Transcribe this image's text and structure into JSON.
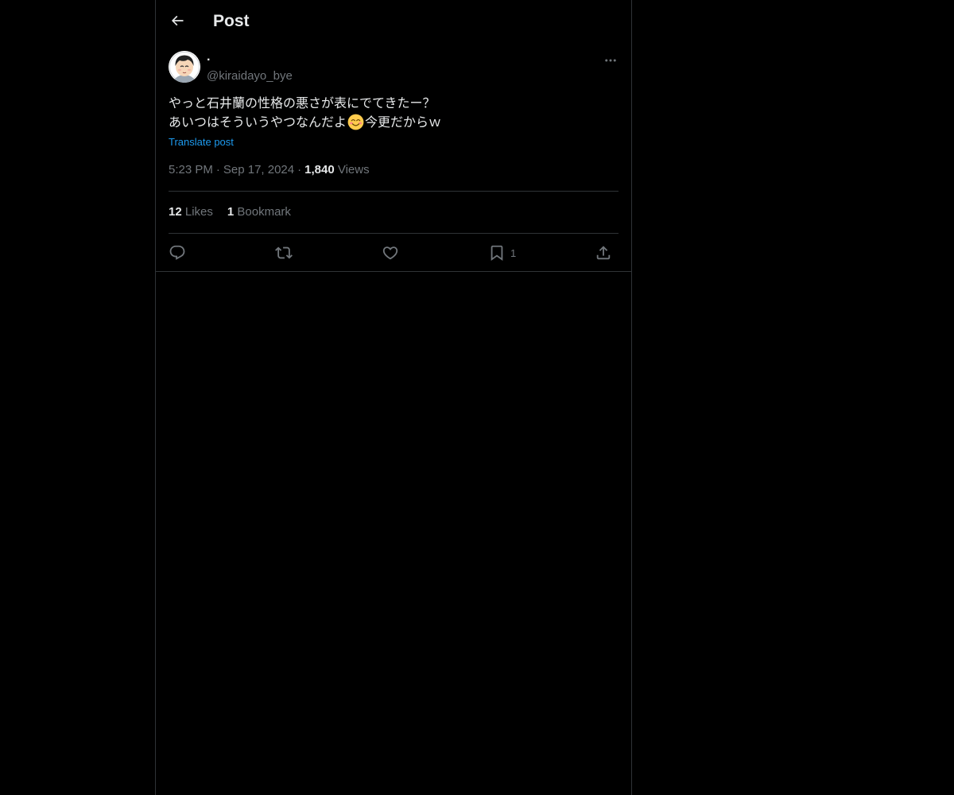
{
  "header": {
    "title": "Post"
  },
  "author": {
    "display_name": "·",
    "handle": "@kiraidayo_bye"
  },
  "post": {
    "line1": "やっと石井蘭の性格の悪さが表にでてきたー？",
    "line2_before_emoji": "あいつはそういうやつなんだよ",
    "emoji": "smiling-face-emoji",
    "line2_after_emoji": "今更だからｗ",
    "translate_label": "Translate post",
    "time": "5:23 PM",
    "date": "Sep 17, 2024",
    "separator": "·",
    "views_count": "1,840",
    "views_label": "Views"
  },
  "stats": {
    "likes_count": "12",
    "likes_label": "Likes",
    "bookmarks_count": "1",
    "bookmarks_label": "Bookmark"
  },
  "actions": {
    "reply_icon": "reply-icon",
    "repost_icon": "repost-icon",
    "like_icon": "heart-icon",
    "bookmark_icon": "bookmark-icon",
    "bookmark_count": "1",
    "share_icon": "share-icon"
  },
  "colors": {
    "background": "#000000",
    "text": "#e7e9ea",
    "secondary": "#71767b",
    "link": "#1d9bf0",
    "border": "#2f3336"
  }
}
